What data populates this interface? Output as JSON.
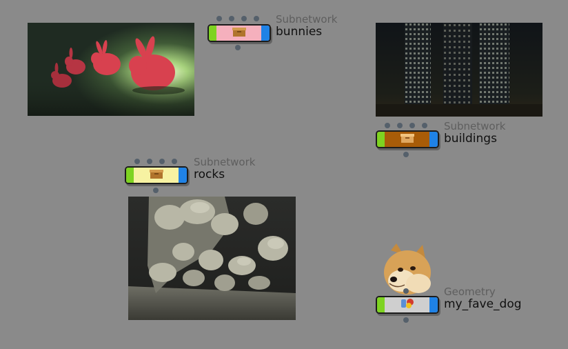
{
  "nodes": [
    {
      "id": "bunnies",
      "type": "Subnetwork",
      "name": "bunnies",
      "color": "#f5b0bd",
      "icon": "subnetwork-box-icon"
    },
    {
      "id": "buildings",
      "type": "Subnetwork",
      "name": "buildings",
      "color": "#a85c08",
      "icon": "subnetwork-box-icon"
    },
    {
      "id": "rocks",
      "type": "Subnetwork",
      "name": "rocks",
      "color": "#f7f2a2",
      "icon": "subnetwork-box-icon"
    },
    {
      "id": "dog",
      "type": "Geometry",
      "name": "my_fave_dog",
      "color": "#cfcfcf",
      "icon": "geometry-shapes-icon"
    }
  ],
  "colors": {
    "background": "#8a8a8a",
    "input_flag": "#7ed321",
    "display_flag": "#1f82e6",
    "connector": "#55606b"
  }
}
